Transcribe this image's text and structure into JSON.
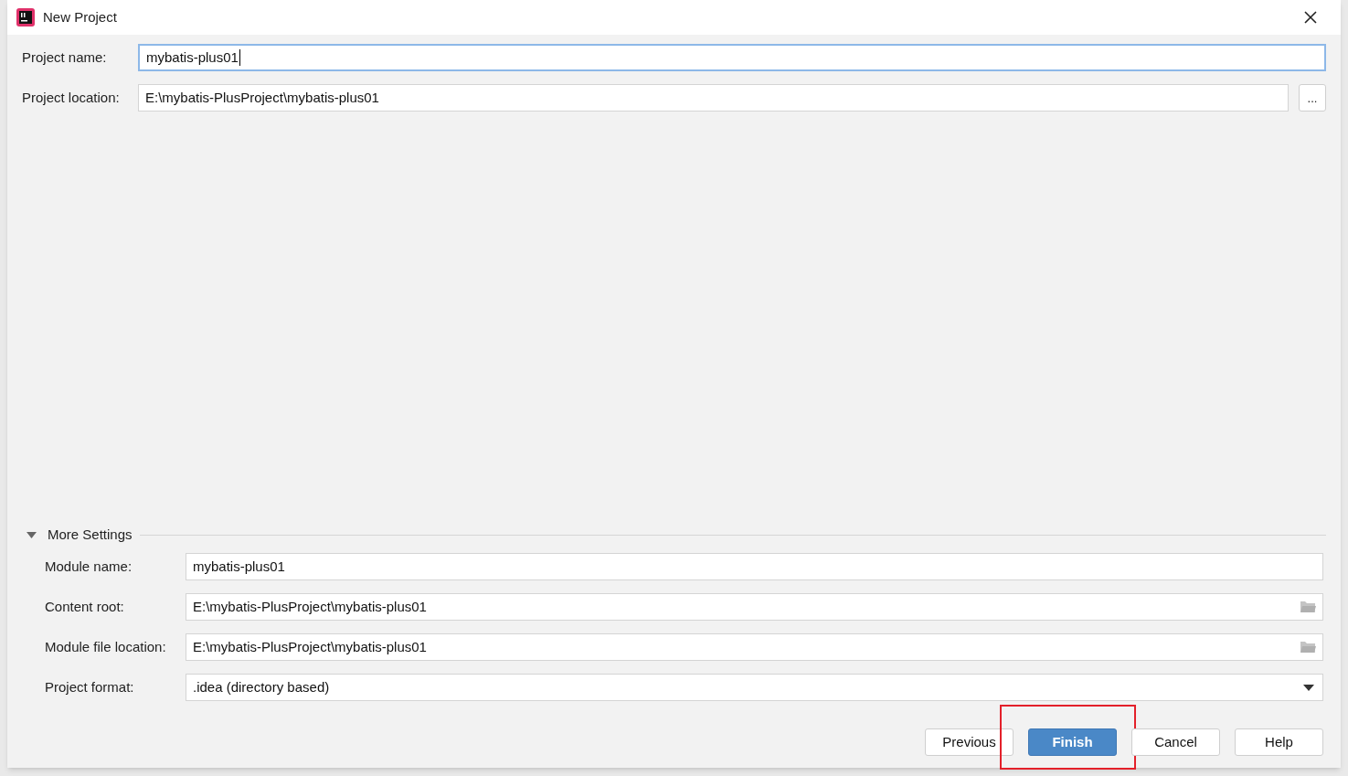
{
  "window": {
    "title": "New Project"
  },
  "fields": [
    {
      "label": "Project name:",
      "value": "mybatis-plus01",
      "kind": "text",
      "focused": true
    },
    {
      "label": "Project location:",
      "value": "E:\\mybatis-PlusProject\\mybatis-plus01",
      "kind": "browse",
      "browse_label": "...",
      "focused": false
    }
  ],
  "more_settings": {
    "title": "More Settings",
    "expanded": true,
    "fields": [
      {
        "label": "Module name:",
        "value": "mybatis-plus01",
        "kind": "text"
      },
      {
        "label": "Content root:",
        "value": "E:\\mybatis-PlusProject\\mybatis-plus01",
        "kind": "folder"
      },
      {
        "label": "Module file location:",
        "value": "E:\\mybatis-PlusProject\\mybatis-plus01",
        "kind": "folder"
      },
      {
        "label": "Project format:",
        "value": ".idea (directory based)",
        "kind": "dropdown"
      }
    ]
  },
  "buttons": [
    {
      "label": "Previous",
      "default": false,
      "highlighted": false
    },
    {
      "label": "Finish",
      "default": true,
      "highlighted": true
    },
    {
      "label": "Cancel",
      "default": false,
      "highlighted": false
    },
    {
      "label": "Help",
      "default": false,
      "highlighted": false
    }
  ]
}
